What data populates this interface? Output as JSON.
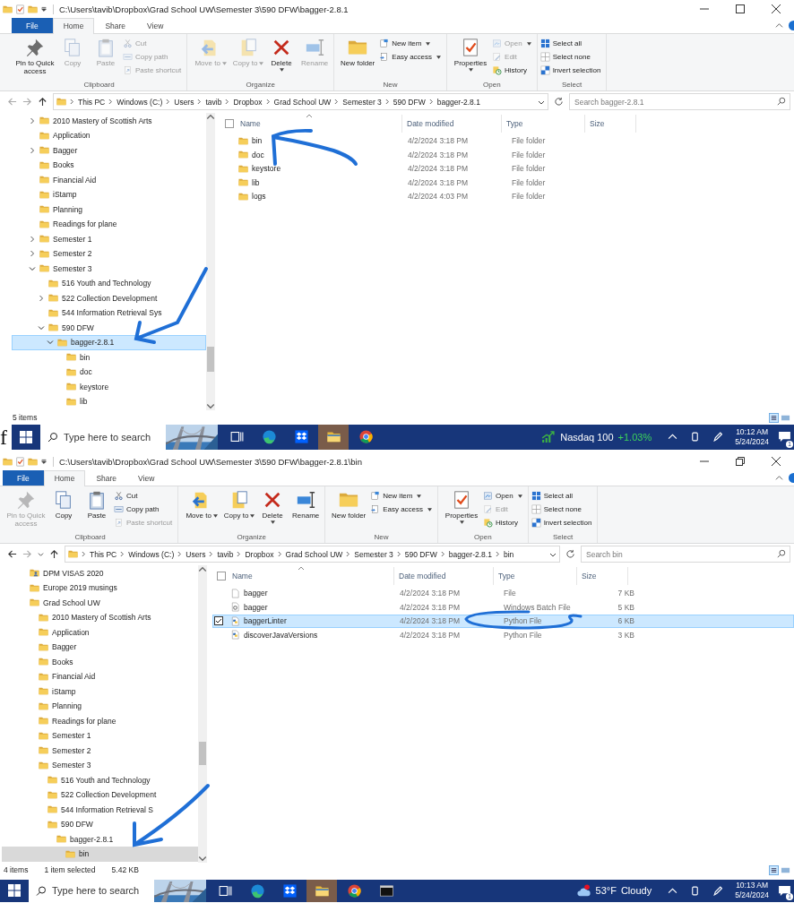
{
  "windows": [
    {
      "title_path": "C:\\Users\\tavib\\Dropbox\\Grad School UW\\Semester 3\\590 DFW\\bagger-2.8.1",
      "maximized": false,
      "tabs": [
        {
          "label": "File",
          "kind": "file",
          "selected": false
        },
        {
          "label": "Home",
          "kind": "tab",
          "selected": true
        },
        {
          "label": "Share",
          "kind": "tab",
          "selected": false
        },
        {
          "label": "View",
          "kind": "tab",
          "selected": false
        }
      ],
      "ribbon": [
        {
          "label": "Clipboard",
          "large": [
            {
              "label": "Pin to Quick access",
              "kind": "pin",
              "disabled": false
            },
            {
              "label": "Copy",
              "kind": "copy",
              "disabled": true
            },
            {
              "label": "Paste",
              "kind": "paste",
              "disabled": true
            }
          ],
          "small": [
            {
              "label": "Cut",
              "kind": "cut",
              "disabled": true
            },
            {
              "label": "Copy path",
              "kind": "copypath",
              "disabled": true
            },
            {
              "label": "Paste shortcut",
              "kind": "pasteshortcut",
              "disabled": true
            }
          ]
        },
        {
          "label": "Organize",
          "large": [
            {
              "label": "Move to",
              "kind": "move",
              "disabled": true,
              "dropdown": true
            },
            {
              "label": "Copy to",
              "kind": "copyto",
              "disabled": true,
              "dropdown": true
            },
            {
              "label": "Delete",
              "kind": "delete",
              "disabled": false,
              "dropdown": true,
              "caret_below": true
            },
            {
              "label": "Rename",
              "kind": "rename",
              "disabled": true
            }
          ]
        },
        {
          "label": "New",
          "large": [
            {
              "label": "New folder",
              "kind": "newfolder",
              "disabled": false
            }
          ],
          "small": [
            {
              "label": "New item",
              "kind": "newitem",
              "disabled": false,
              "dropdown": true
            },
            {
              "label": "Easy access",
              "kind": "easyaccess",
              "disabled": false,
              "dropdown": true
            }
          ]
        },
        {
          "label": "Open",
          "large": [
            {
              "label": "Properties",
              "kind": "properties",
              "disabled": false,
              "dropdown": true,
              "caret_below": true
            }
          ],
          "small": [
            {
              "label": "Open",
              "kind": "open",
              "disabled": true,
              "dropdown": true
            },
            {
              "label": "Edit",
              "kind": "edit",
              "disabled": true
            },
            {
              "label": "History",
              "kind": "history",
              "disabled": false
            }
          ]
        },
        {
          "label": "Select",
          "small": [
            {
              "label": "Select all",
              "kind": "selectall",
              "disabled": false
            },
            {
              "label": "Select none",
              "kind": "selectnone",
              "disabled": false
            },
            {
              "label": "Invert selection",
              "kind": "invert",
              "disabled": false
            }
          ]
        }
      ],
      "address": {
        "back_enabled": false,
        "segments": [
          "This PC",
          "Windows (C:)",
          "Users",
          "tavib",
          "Dropbox",
          "Grad School UW",
          "Semester 3",
          "590 DFW",
          "bagger-2.8.1"
        ],
        "search_placeholder": "Search bagger-2.8.1"
      },
      "tree": {
        "focused": true,
        "items": [
          {
            "name": "2010 Mastery of Scottish Arts",
            "kind": "folder",
            "expandable": true,
            "expanded": false,
            "selected": false
          },
          {
            "name": "Application",
            "kind": "folder",
            "expandable": false,
            "selected": false
          },
          {
            "name": "Bagger",
            "kind": "folder",
            "expandable": true,
            "expanded": false,
            "selected": false
          },
          {
            "name": "Books",
            "kind": "folder",
            "expandable": false,
            "selected": false
          },
          {
            "name": "Financial Aid",
            "kind": "folder",
            "expandable": false,
            "selected": false
          },
          {
            "name": "iStamp",
            "kind": "folder",
            "expandable": false,
            "selected": false
          },
          {
            "name": "Planning",
            "kind": "folder",
            "expandable": false,
            "selected": false
          },
          {
            "name": "Readings for plane",
            "kind": "folder",
            "expandable": false,
            "selected": false
          },
          {
            "name": "Semester 1",
            "kind": "folder",
            "expandable": true,
            "expanded": false,
            "selected": false
          },
          {
            "name": "Semester 2",
            "kind": "folder",
            "expandable": true,
            "expanded": false,
            "selected": false
          },
          {
            "name": "Semester 3",
            "kind": "folder",
            "expandable": true,
            "expanded": true,
            "selected": false,
            "children": [
              {
                "name": "516 Youth and Technology",
                "kind": "folder",
                "expandable": false,
                "selected": false
              },
              {
                "name": "522 Collection Development",
                "kind": "folder",
                "expandable": true,
                "expanded": false,
                "selected": false
              },
              {
                "name": "544 Information Retrieval Sys",
                "kind": "folder",
                "expandable": false,
                "selected": false
              },
              {
                "name": "590 DFW",
                "kind": "folder",
                "expandable": true,
                "expanded": true,
                "selected": false,
                "children": [
                  {
                    "name": "bagger-2.8.1",
                    "kind": "folder",
                    "expandable": true,
                    "expanded": true,
                    "selected": true,
                    "children": [
                      {
                        "name": "bin",
                        "kind": "folder",
                        "expandable": false,
                        "selected": false
                      },
                      {
                        "name": "doc",
                        "kind": "folder",
                        "expandable": false,
                        "selected": false
                      },
                      {
                        "name": "keystore",
                        "kind": "folder",
                        "expandable": false,
                        "selected": false
                      },
                      {
                        "name": "lib",
                        "kind": "folder",
                        "expandable": false,
                        "selected": false
                      }
                    ]
                  }
                ]
              }
            ]
          }
        ]
      },
      "files": {
        "columns": [
          "Name",
          "Date modified",
          "Type",
          "Size"
        ],
        "header_checked": false,
        "rows": [
          {
            "name": "bin",
            "kind": "folder",
            "date": "4/2/2024 3:18 PM",
            "type": "File folder",
            "selected": false
          },
          {
            "name": "doc",
            "kind": "folder",
            "date": "4/2/2024 3:18 PM",
            "type": "File folder",
            "selected": false
          },
          {
            "name": "keystore",
            "kind": "folder",
            "date": "4/2/2024 3:18 PM",
            "type": "File folder",
            "selected": false
          },
          {
            "name": "lib",
            "kind": "folder",
            "date": "4/2/2024 3:18 PM",
            "type": "File folder",
            "selected": false
          },
          {
            "name": "logs",
            "kind": "folder",
            "date": "4/2/2024 4:03 PM",
            "type": "File folder",
            "selected": false
          }
        ]
      },
      "status": [
        "5 items"
      ],
      "margin_text": "f",
      "taskbar": {
        "search_placeholder": "Type here to search",
        "apps": [
          {
            "kind": "taskview",
            "active": false
          },
          {
            "kind": "edge",
            "active": false
          },
          {
            "kind": "dropbox",
            "active": false
          },
          {
            "kind": "explorer",
            "active": true
          },
          {
            "kind": "chrome",
            "active": false
          }
        ],
        "widget": {
          "kind": "stock",
          "label": "Nasdaq 100",
          "value": "+1.03%"
        },
        "time": "10:12 AM",
        "date": "5/24/2024",
        "notifications": "1"
      }
    },
    {
      "title_path": "C:\\Users\\tavib\\Dropbox\\Grad School UW\\Semester 3\\590 DFW\\bagger-2.8.1\\bin",
      "maximized": true,
      "tabs": [
        {
          "label": "File",
          "kind": "file",
          "selected": false
        },
        {
          "label": "Home",
          "kind": "tab",
          "selected": true
        },
        {
          "label": "Share",
          "kind": "tab",
          "selected": false
        },
        {
          "label": "View",
          "kind": "tab",
          "selected": false
        }
      ],
      "ribbon": [
        {
          "label": "Clipboard",
          "large": [
            {
              "label": "Pin to Quick access",
              "kind": "pin",
              "disabled": true
            },
            {
              "label": "Copy",
              "kind": "copy",
              "disabled": false
            },
            {
              "label": "Paste",
              "kind": "paste",
              "disabled": false
            }
          ],
          "small": [
            {
              "label": "Cut",
              "kind": "cut",
              "disabled": false
            },
            {
              "label": "Copy path",
              "kind": "copypath",
              "disabled": false
            },
            {
              "label": "Paste shortcut",
              "kind": "pasteshortcut",
              "disabled": true
            }
          ]
        },
        {
          "label": "Organize",
          "large": [
            {
              "label": "Move to",
              "kind": "move",
              "disabled": false,
              "dropdown": true
            },
            {
              "label": "Copy to",
              "kind": "copyto",
              "disabled": false,
              "dropdown": true
            },
            {
              "label": "Delete",
              "kind": "delete",
              "disabled": false,
              "dropdown": true,
              "caret_below": true
            },
            {
              "label": "Rename",
              "kind": "rename",
              "disabled": false
            }
          ]
        },
        {
          "label": "New",
          "large": [
            {
              "label": "New folder",
              "kind": "newfolder",
              "disabled": false
            }
          ],
          "small": [
            {
              "label": "New item",
              "kind": "newitem",
              "disabled": false,
              "dropdown": true
            },
            {
              "label": "Easy access",
              "kind": "easyaccess",
              "disabled": false,
              "dropdown": true
            }
          ]
        },
        {
          "label": "Open",
          "large": [
            {
              "label": "Properties",
              "kind": "properties",
              "disabled": false,
              "dropdown": true,
              "caret_below": true
            }
          ],
          "small": [
            {
              "label": "Open",
              "kind": "open",
              "disabled": false,
              "dropdown": true
            },
            {
              "label": "Edit",
              "kind": "edit",
              "disabled": true
            },
            {
              "label": "History",
              "kind": "history",
              "disabled": false
            }
          ]
        },
        {
          "label": "Select",
          "small": [
            {
              "label": "Select all",
              "kind": "selectall",
              "disabled": false
            },
            {
              "label": "Select none",
              "kind": "selectnone",
              "disabled": false
            },
            {
              "label": "Invert selection",
              "kind": "invert",
              "disabled": false
            }
          ]
        }
      ],
      "address": {
        "back_enabled": true,
        "recent_dropdown": true,
        "segments": [
          "This PC",
          "Windows (C:)",
          "Users",
          "tavib",
          "Dropbox",
          "Grad School UW",
          "Semester 3",
          "590 DFW",
          "bagger-2.8.1",
          "bin"
        ],
        "search_placeholder": "Search bin"
      },
      "tree": {
        "focused": false,
        "items": [
          {
            "name": "DPM VISAS 2020",
            "kind": "user-folder",
            "expandable": false,
            "selected": false
          },
          {
            "name": "Europe 2019 musings",
            "kind": "folder",
            "expandable": false,
            "selected": false
          },
          {
            "name": "Grad School UW",
            "kind": "folder",
            "expandable": false,
            "selected": false,
            "children": [
              {
                "name": "2010 Mastery of Scottish Arts",
                "kind": "folder",
                "expandable": false,
                "selected": false
              },
              {
                "name": "Application",
                "kind": "folder",
                "expandable": false,
                "selected": false
              },
              {
                "name": "Bagger",
                "kind": "folder",
                "expandable": false,
                "selected": false
              },
              {
                "name": "Books",
                "kind": "folder",
                "expandable": false,
                "selected": false
              },
              {
                "name": "Financial Aid",
                "kind": "folder",
                "expandable": false,
                "selected": false
              },
              {
                "name": "iStamp",
                "kind": "folder",
                "expandable": false,
                "selected": false
              },
              {
                "name": "Planning",
                "kind": "folder",
                "expandable": false,
                "selected": false
              },
              {
                "name": "Readings for plane",
                "kind": "folder",
                "expandable": false,
                "selected": false
              },
              {
                "name": "Semester 1",
                "kind": "folder",
                "expandable": false,
                "selected": false
              },
              {
                "name": "Semester 2",
                "kind": "folder",
                "expandable": false,
                "selected": false
              },
              {
                "name": "Semester 3",
                "kind": "folder",
                "expandable": false,
                "selected": false,
                "children": [
                  {
                    "name": "516 Youth and Technology",
                    "kind": "folder",
                    "expandable": false,
                    "selected": false
                  },
                  {
                    "name": "522 Collection Development",
                    "kind": "folder",
                    "expandable": false,
                    "selected": false
                  },
                  {
                    "name": "544 Information Retrieval S",
                    "kind": "folder",
                    "expandable": false,
                    "selected": false
                  },
                  {
                    "name": "590 DFW",
                    "kind": "folder",
                    "expandable": false,
                    "selected": false,
                    "children": [
                      {
                        "name": "bagger-2.8.1",
                        "kind": "folder",
                        "expandable": false,
                        "selected": false,
                        "children": [
                          {
                            "name": "bin",
                            "kind": "folder",
                            "expandable": false,
                            "selected": true
                          }
                        ]
                      }
                    ]
                  }
                ]
              }
            ]
          }
        ]
      },
      "files": {
        "columns": [
          "Name",
          "Date modified",
          "Type",
          "Size"
        ],
        "header_checked": false,
        "rows": [
          {
            "name": "bagger",
            "kind": "file",
            "date": "4/2/2024 3:18 PM",
            "type": "File",
            "size": "7 KB",
            "selected": false
          },
          {
            "name": "bagger",
            "kind": "batch",
            "date": "4/2/2024 3:18 PM",
            "type": "Windows Batch File",
            "size": "5 KB",
            "selected": false
          },
          {
            "name": "baggerLinter",
            "kind": "python",
            "date": "4/2/2024 3:18 PM",
            "type": "Python File",
            "size": "6 KB",
            "selected": true
          },
          {
            "name": "discoverJavaVersions",
            "kind": "python",
            "date": "4/2/2024 3:18 PM",
            "type": "Python File",
            "size": "3 KB",
            "selected": false
          }
        ]
      },
      "status": [
        "4 items",
        "1 item selected",
        "5.42 KB"
      ],
      "taskbar": {
        "search_placeholder": "Type here to search",
        "apps": [
          {
            "kind": "taskview",
            "active": false
          },
          {
            "kind": "edge",
            "active": false
          },
          {
            "kind": "dropbox",
            "active": false
          },
          {
            "kind": "explorer",
            "active": true
          },
          {
            "kind": "chrome",
            "active": false
          },
          {
            "kind": "terminal",
            "active": false
          }
        ],
        "widget": {
          "kind": "weather",
          "label": "53°F",
          "value": "Cloudy"
        },
        "time": "10:13 AM",
        "date": "5/24/2024",
        "notifications": "1"
      }
    }
  ]
}
